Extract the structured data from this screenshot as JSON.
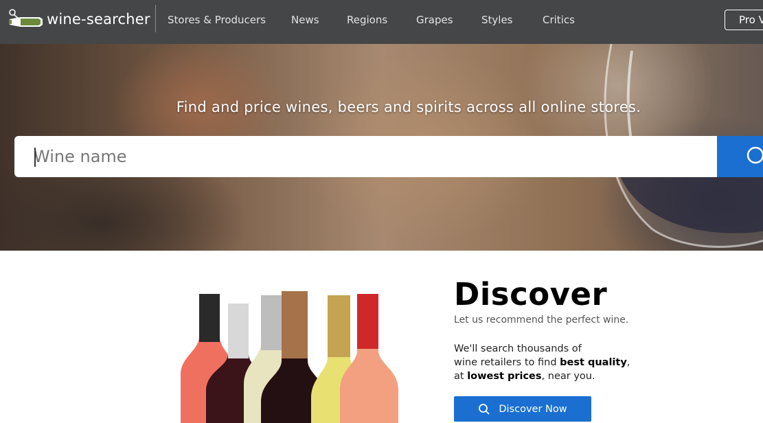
{
  "brand": {
    "name": "wine-searcher"
  },
  "nav": {
    "items": [
      {
        "label": "Stores & Producers"
      },
      {
        "label": "News"
      },
      {
        "label": "Regions"
      },
      {
        "label": "Grapes"
      },
      {
        "label": "Styles"
      },
      {
        "label": "Critics"
      }
    ],
    "pro_label": "Pro Version"
  },
  "hero": {
    "tagline": "Find and price wines, beers and spirits across all online stores.",
    "search_placeholder": "Wine name",
    "search_icon": "search-icon"
  },
  "discover": {
    "title": "Discover",
    "subtitle": "Let us recommend the perfect wine.",
    "line1": "We'll search thousands of",
    "line2_pre": "wine retailers to find ",
    "line2_bold": "best quality",
    "line2_post": ",",
    "line3_pre": "at ",
    "line3_bold": "lowest prices",
    "line3_post": ", near you.",
    "button_label": "Discover Now"
  },
  "colors": {
    "nav_bg": "#444647",
    "accent": "#1a6fd1",
    "logo_green": "#6d8a3a"
  }
}
